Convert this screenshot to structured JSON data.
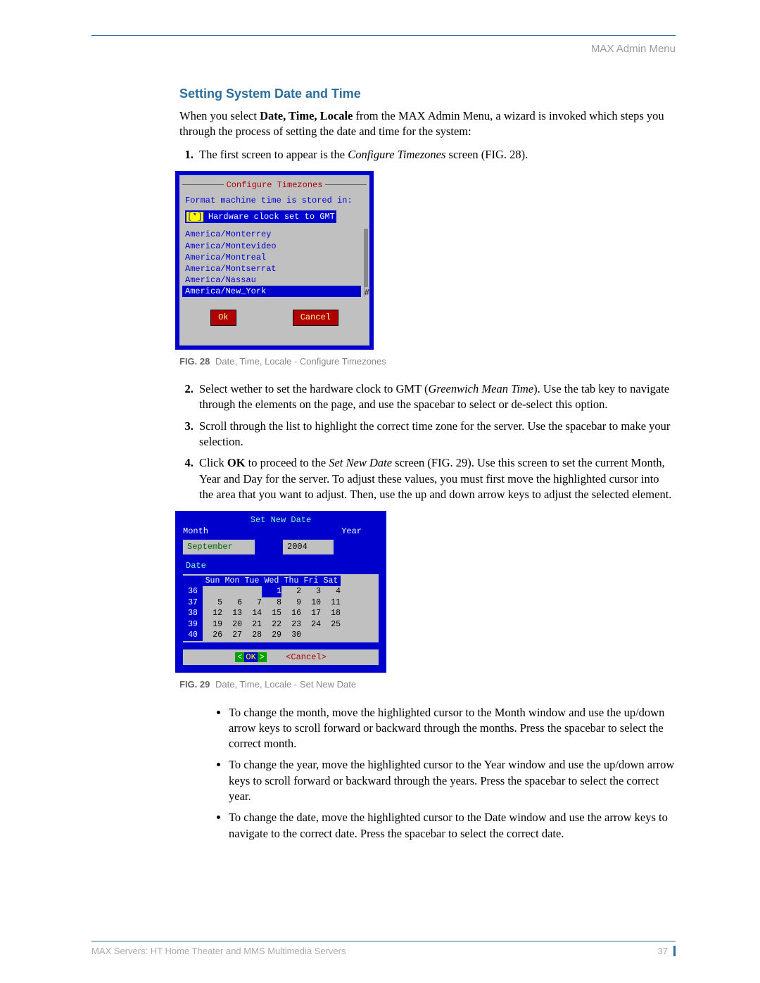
{
  "header": {
    "right": "MAX Admin Menu"
  },
  "section_title": "Setting System Date and Time",
  "intro": {
    "pre": "When you select ",
    "bold": "Date, Time, Locale",
    "post": " from the MAX Admin Menu, a wizard is invoked which steps you through the process of setting the date and time for the system:"
  },
  "step1": {
    "pre": "The first screen to appear is the ",
    "italic": "Configure Timezones",
    "post": " screen (FIG. 28)."
  },
  "fig28": {
    "title": "Configure Timezones",
    "line1": "Format machine time is stored in:",
    "checkbox_marker": "[*]",
    "checkbox_label": "Hardware clock set to GMT",
    "items": [
      "America/Monterrey",
      "America/Montevideo",
      "America/Montreal",
      "America/Montserrat",
      "America/Nassau",
      "America/New_York"
    ],
    "selected_index": 5,
    "ok": "Ok",
    "cancel": "Cancel",
    "caption_label": "FIG. 28",
    "caption_text": "Date, Time, Locale - Configure Timezones"
  },
  "step2": {
    "pre": "Select wether to set the hardware clock to GMT (",
    "italic": "Greenwich Mean Time",
    "post": "). Use the tab key to navigate through the elements on the page, and use the spacebar to select or de-select this option."
  },
  "step3": "Scroll through the list to highlight the correct time zone for the server. Use the spacebar to make your selection.",
  "step4": {
    "t1": "Click ",
    "b1": "OK",
    "t2": " to proceed to the ",
    "i1": "Set New Date",
    "t3": " screen (FIG. 29). Use this screen to set the current Month, Year and Day for the server. To adjust these values, you must first move the highlighted cursor into the area that you want to adjust. Then, use the up and down arrow keys to adjust the selected element."
  },
  "fig29": {
    "title": "Set New Date",
    "label_month": "Month",
    "label_year": "Year",
    "month_value": "September",
    "year_value": "2004",
    "date_label": "Date",
    "dow": [
      "Sun",
      "Mon",
      "Tue",
      "Wed",
      "Thu",
      "Fri",
      "Sat"
    ],
    "weeks": [
      {
        "wk": "36",
        "days": [
          "",
          "",
          "",
          "1",
          "2",
          "3",
          "4"
        ]
      },
      {
        "wk": "37",
        "days": [
          "5",
          "6",
          "7",
          "8",
          "9",
          "10",
          "11"
        ]
      },
      {
        "wk": "38",
        "days": [
          "12",
          "13",
          "14",
          "15",
          "16",
          "17",
          "18"
        ]
      },
      {
        "wk": "39",
        "days": [
          "19",
          "20",
          "21",
          "22",
          "23",
          "24",
          "25"
        ]
      },
      {
        "wk": "40",
        "days": [
          "26",
          "27",
          "28",
          "29",
          "30",
          "",
          ""
        ]
      }
    ],
    "selected_day": "1",
    "ok_arrow_l": "<",
    "ok": "OK",
    "ok_arrow_r": ">",
    "cancel": "<Cancel>",
    "caption_label": "FIG. 29",
    "caption_text": "Date, Time, Locale - Set New Date"
  },
  "bullets": {
    "b1": "To change the month, move the highlighted cursor to the Month window and use the up/down arrow keys to scroll forward or backward through the months. Press the spacebar to select the correct month.",
    "b2": "To change the year, move the highlighted cursor to the Year window and use the up/down arrow keys to scroll forward or backward through the years. Press the spacebar to select the correct year.",
    "b3": "To change the date, move the highlighted cursor to the Date window and use the arrow keys to navigate to the correct date. Press the spacebar to select the correct date."
  },
  "footer": {
    "left": "MAX Servers: HT Home Theater and MMS Multimedia Servers",
    "page": "37"
  }
}
